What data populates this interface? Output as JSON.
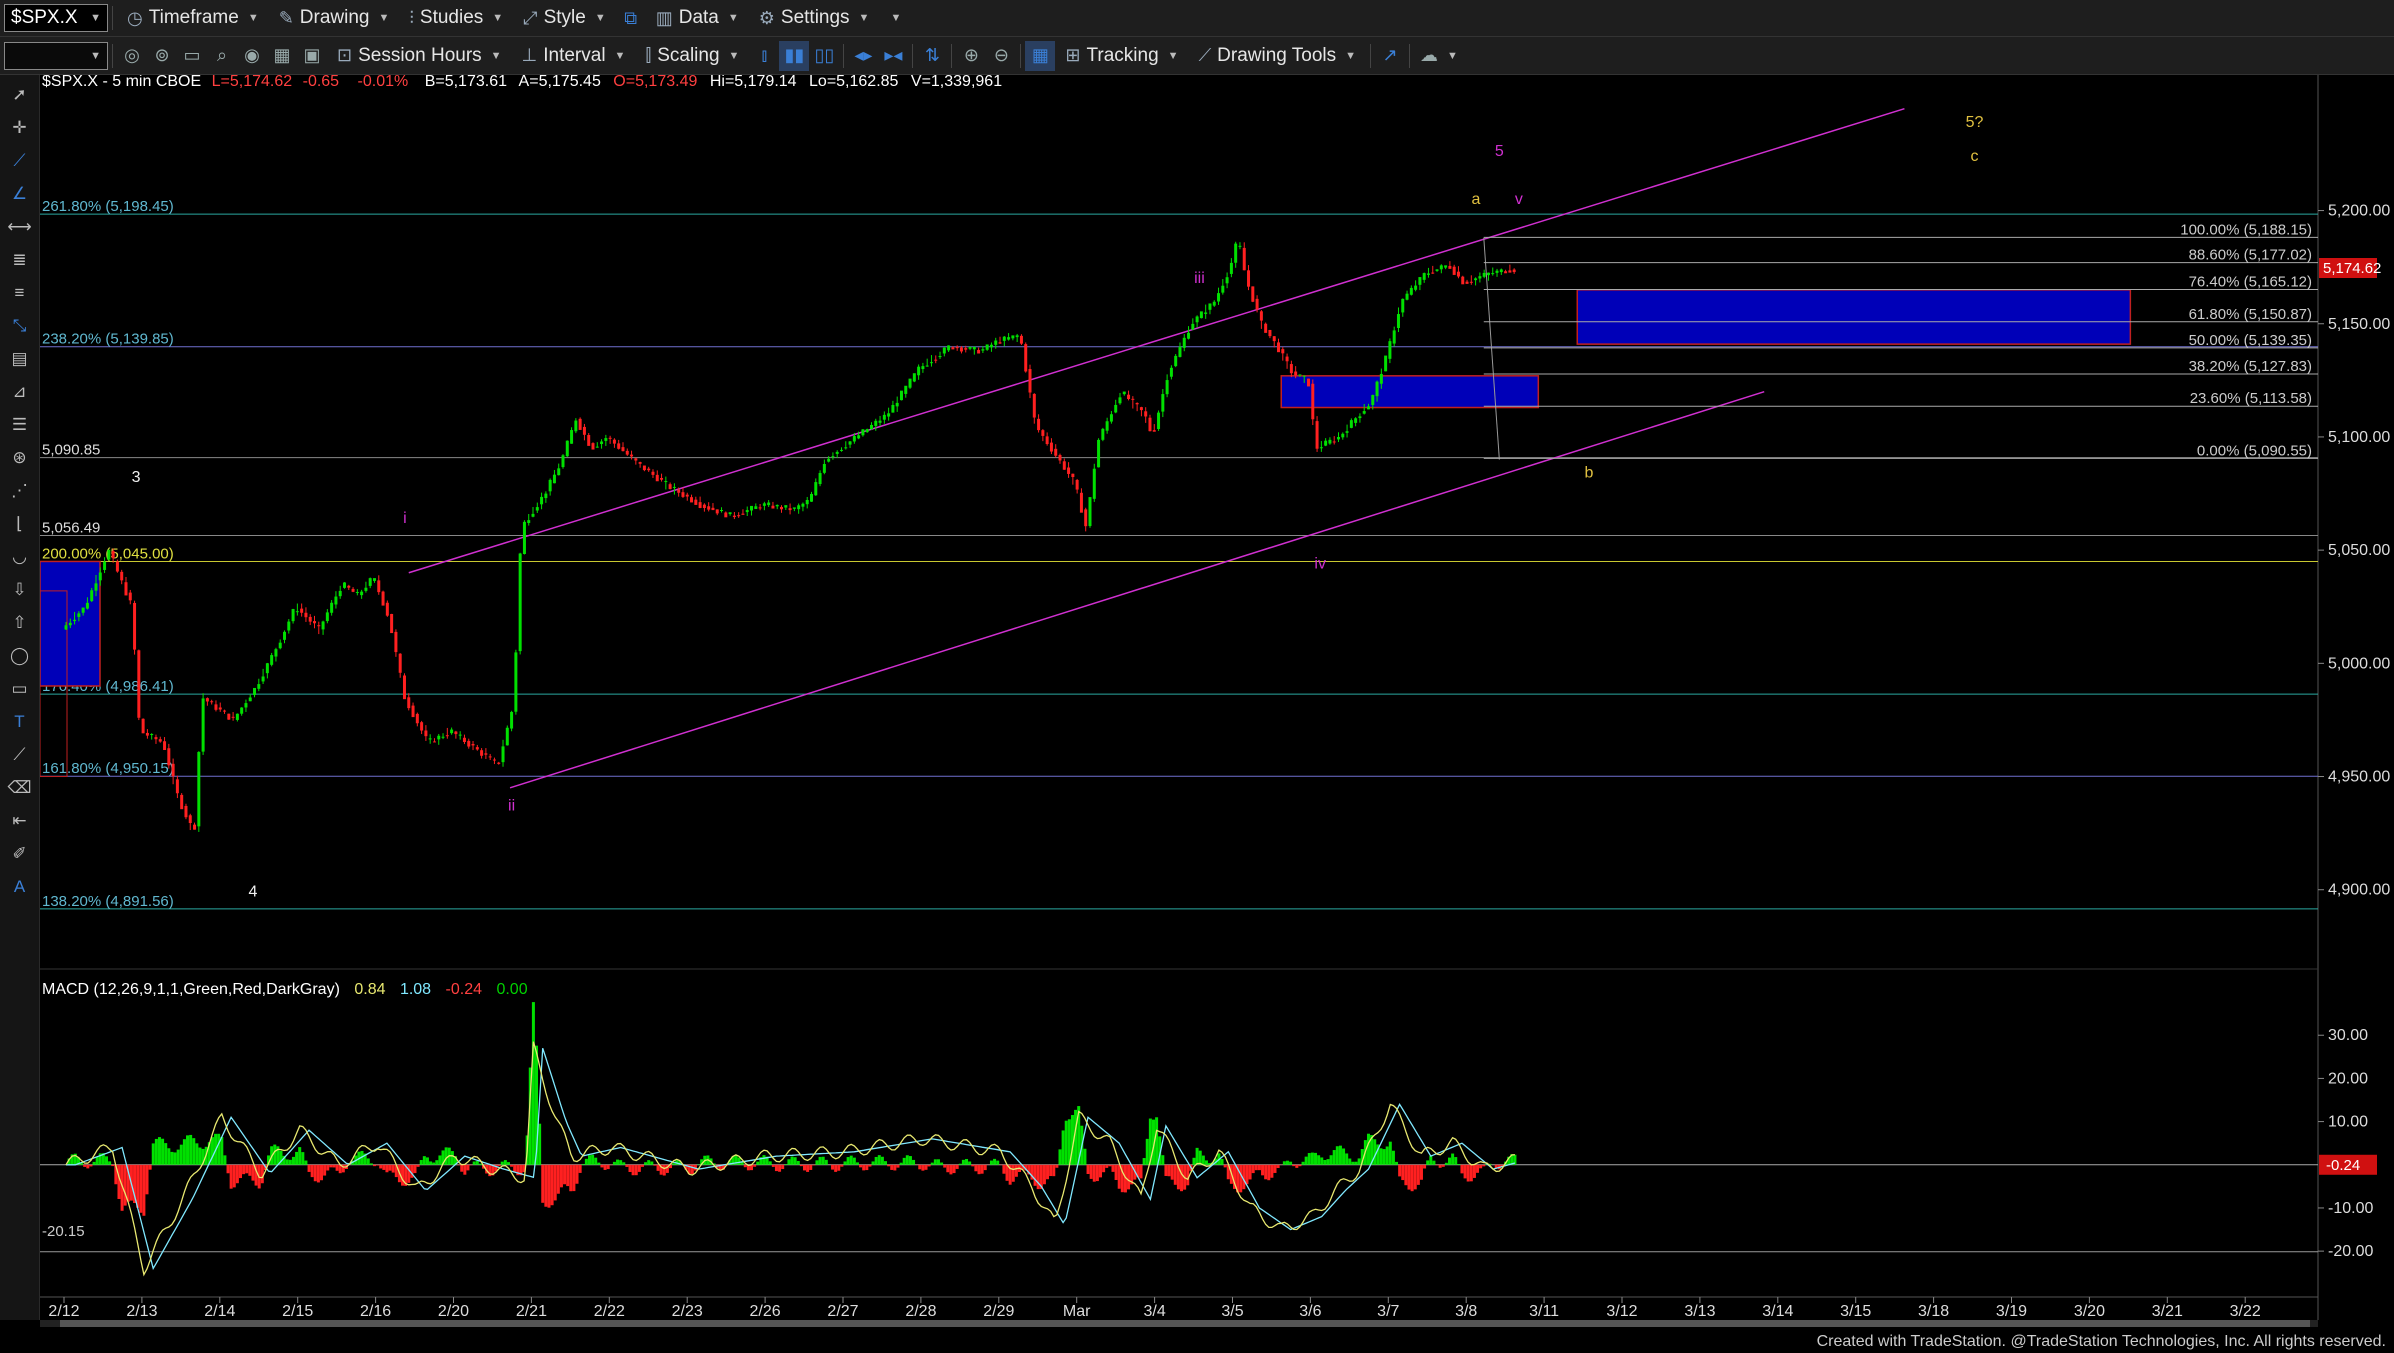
{
  "toolbar": {
    "symbol": "$SPX.X",
    "timeframe": "Timeframe",
    "drawing": "Drawing",
    "studies": "Studies",
    "style": "Style",
    "data": "Data",
    "settings": "Settings",
    "session_hours": "Session Hours",
    "interval": "Interval",
    "scaling": "Scaling",
    "tracking": "Tracking",
    "drawing_tools": "Drawing Tools"
  },
  "header": {
    "symbol_info": "$SPX.X - 5 min  CBOE",
    "last": "L=5,174.62",
    "change": "-0.65",
    "pct": "-0.01%",
    "bid": "B=5,173.61",
    "ask": "A=5,175.45",
    "open": "O=5,173.49",
    "high": "Hi=5,179.14",
    "low": "Lo=5,162.85",
    "volume": "V=1,339,961"
  },
  "macd": {
    "label": "MACD (12,26,9,1,1,Green,Red,DarkGray)",
    "v1": "0.84",
    "v2": "1.08",
    "v3": "-0.24",
    "v4": "0.00",
    "min_label": "-20.15",
    "last_tag": "-0.24"
  },
  "footer": "Created with TradeStation. @TradeStation Technologies, Inc. All rights reserved.",
  "colors": {
    "up": "#00e000",
    "down": "#ff2020",
    "channel": "#d030d0",
    "zone": "#0000b8",
    "fib_left": "#2aa8a0",
    "macd_line": "#e8e870",
    "signal_line": "#80e8ff"
  },
  "chart_data": {
    "type": "line",
    "title": "$SPX.X - 5 min",
    "price_axis": {
      "ticks": [
        "5,200.00",
        "5,150.00",
        "5,100.00",
        "5,050.00",
        "5,000.00",
        "4,950.00",
        "4,900.00"
      ],
      "ylim": [
        4880,
        5240
      ],
      "last_tag": "5,174.62"
    },
    "macd_axis": {
      "ticks": [
        "30.00",
        "20.00",
        "10.00",
        "-10.00",
        "-20.00"
      ],
      "ylim": [
        -29,
        37
      ]
    },
    "x_labels": [
      "2/12",
      "2/13",
      "2/14",
      "2/15",
      "2/16",
      "2/20",
      "2/21",
      "2/22",
      "2/23",
      "2/26",
      "2/27",
      "2/28",
      "2/29",
      "Mar",
      "3/4",
      "3/5",
      "3/6",
      "3/7",
      "3/8",
      "3/11",
      "3/12",
      "3/13",
      "3/14",
      "3/15",
      "3/18",
      "3/19",
      "3/20",
      "3/21",
      "3/22"
    ],
    "price_path": [
      [
        0,
        5015
      ],
      [
        0.3,
        5025
      ],
      [
        0.6,
        5050
      ],
      [
        0.9,
        5025
      ],
      [
        1,
        4970
      ],
      [
        1.3,
        4965
      ],
      [
        1.5,
        4940
      ],
      [
        1.7,
        4925
      ],
      [
        1.8,
        4985
      ],
      [
        2.2,
        4975
      ],
      [
        2.5,
        4990
      ],
      [
        2.8,
        5010
      ],
      [
        3,
        5025
      ],
      [
        3.3,
        5015
      ],
      [
        3.6,
        5035
      ],
      [
        3.8,
        5030
      ],
      [
        4,
        5038
      ],
      [
        4.2,
        5020
      ],
      [
        4.4,
        4985
      ],
      [
        4.7,
        4965
      ],
      [
        5,
        4970
      ],
      [
        5.4,
        4960
      ],
      [
        5.6,
        4955
      ],
      [
        5.8,
        4982
      ],
      [
        5.9,
        5060
      ],
      [
        6.2,
        5075
      ],
      [
        6.4,
        5088
      ],
      [
        6.6,
        5108
      ],
      [
        6.8,
        5095
      ],
      [
        7,
        5100
      ],
      [
        7.4,
        5088
      ],
      [
        7.8,
        5078
      ],
      [
        8.2,
        5070
      ],
      [
        8.6,
        5065
      ],
      [
        9,
        5070
      ],
      [
        9.4,
        5068
      ],
      [
        9.6,
        5072
      ],
      [
        9.8,
        5090
      ],
      [
        10.2,
        5100
      ],
      [
        10.6,
        5110
      ],
      [
        11,
        5130
      ],
      [
        11.4,
        5140
      ],
      [
        11.8,
        5138
      ],
      [
        12,
        5142
      ],
      [
        12.3,
        5145
      ],
      [
        12.4,
        5125
      ],
      [
        12.5,
        5105
      ],
      [
        12.8,
        5090
      ],
      [
        13,
        5080
      ],
      [
        13.15,
        5060
      ],
      [
        13.3,
        5098
      ],
      [
        13.6,
        5120
      ],
      [
        13.9,
        5110
      ],
      [
        14,
        5100
      ],
      [
        14.2,
        5128
      ],
      [
        14.5,
        5150
      ],
      [
        14.8,
        5160
      ],
      [
        15,
        5175
      ],
      [
        15.1,
        5188
      ],
      [
        15.2,
        5170
      ],
      [
        15.4,
        5150
      ],
      [
        15.6,
        5140
      ],
      [
        15.8,
        5128
      ],
      [
        16,
        5125
      ],
      [
        16.1,
        5095
      ],
      [
        16.4,
        5100
      ],
      [
        16.6,
        5108
      ],
      [
        16.8,
        5115
      ],
      [
        17,
        5135
      ],
      [
        17.2,
        5160
      ],
      [
        17.5,
        5172
      ],
      [
        17.8,
        5176
      ],
      [
        18,
        5168
      ],
      [
        18.3,
        5172
      ],
      [
        18.6,
        5174
      ]
    ],
    "macd_path": [
      [
        0,
        0
      ],
      [
        0.6,
        4
      ],
      [
        1,
        -24
      ],
      [
        1.5,
        -8
      ],
      [
        2,
        11
      ],
      [
        2.5,
        -2
      ],
      [
        3,
        8
      ],
      [
        3.5,
        0
      ],
      [
        4,
        5
      ],
      [
        4.5,
        -6
      ],
      [
        5,
        2
      ],
      [
        5.5,
        -1
      ],
      [
        5.9,
        -3
      ],
      [
        6,
        27
      ],
      [
        6.3,
        10
      ],
      [
        6.5,
        2
      ],
      [
        7,
        4
      ],
      [
        8,
        -1
      ],
      [
        9,
        2
      ],
      [
        10,
        3
      ],
      [
        11,
        6
      ],
      [
        12,
        3
      ],
      [
        12.4,
        -5
      ],
      [
        12.7,
        -14
      ],
      [
        13,
        11
      ],
      [
        13.4,
        5
      ],
      [
        13.8,
        -8
      ],
      [
        14,
        9
      ],
      [
        14.4,
        -3
      ],
      [
        14.8,
        3
      ],
      [
        15.2,
        -10
      ],
      [
        15.6,
        -15
      ],
      [
        16,
        -12
      ],
      [
        16.3,
        -6
      ],
      [
        16.6,
        -1
      ],
      [
        17,
        14
      ],
      [
        17.4,
        2
      ],
      [
        17.8,
        5
      ],
      [
        18.2,
        -1
      ],
      [
        18.6,
        1
      ]
    ],
    "fib_left": [
      {
        "label": "261.80% (5,198.45)",
        "v": 5198.45
      },
      {
        "label": "238.20% (5,139.85)",
        "v": 5139.85
      },
      {
        "label": "5,090.85",
        "v": 5090.85
      },
      {
        "label": "5,056.49",
        "v": 5056.49
      },
      {
        "label": "200.00% (5,045.00)",
        "v": 5045.0
      },
      {
        "label": "176.40% (4,986.41)",
        "v": 4986.41
      },
      {
        "label": "161.80% (4,950.15)",
        "v": 4950.15
      },
      {
        "label": "138.20% (4,891.56)",
        "v": 4891.56
      }
    ],
    "fib_right": [
      {
        "label": "100.00% (5,188.15)",
        "v": 5188.15
      },
      {
        "label": "88.60% (5,177.02)",
        "v": 5177.02
      },
      {
        "label": "76.40% (5,165.12)",
        "v": 5165.12
      },
      {
        "label": "61.80% (5,150.87)",
        "v": 5150.87
      },
      {
        "label": "50.00% (5,139.35)",
        "v": 5139.35
      },
      {
        "label": "38.20% (5,127.83)",
        "v": 5127.83
      },
      {
        "label": "23.60% (5,113.58)",
        "v": 5113.58
      },
      {
        "label": "0.00% (5,090.55)",
        "v": 5090.55
      }
    ],
    "wave_labels": [
      {
        "t": "3",
        "x": 0.9,
        "v": 5080,
        "c": "#f0f0f0"
      },
      {
        "t": "4",
        "x": 2.4,
        "v": 4897,
        "c": "#f0f0f0"
      },
      {
        "t": "i",
        "x": 4.35,
        "v": 5062,
        "c": "#d030d0"
      },
      {
        "t": "ii",
        "x": 5.72,
        "v": 4935,
        "c": "#d030d0"
      },
      {
        "t": "iii",
        "x": 14.55,
        "v": 5168,
        "c": "#d030d0"
      },
      {
        "t": "iv",
        "x": 16.1,
        "v": 5042,
        "c": "#d030d0"
      },
      {
        "t": "5",
        "x": 18.4,
        "v": 5224,
        "c": "#d030d0"
      },
      {
        "t": "v",
        "x": 18.65,
        "v": 5203,
        "c": "#d030d0"
      },
      {
        "t": "a",
        "x": 18.1,
        "v": 5203,
        "c": "#e0c040"
      },
      {
        "t": "b",
        "x": 19.55,
        "v": 5082,
        "c": "#e0c040"
      },
      {
        "t": "5?",
        "x": 24.5,
        "v": 5237,
        "c": "#e0c040"
      },
      {
        "t": "c",
        "x": 24.5,
        "v": 5222,
        "c": "#e0c040"
      }
    ]
  }
}
